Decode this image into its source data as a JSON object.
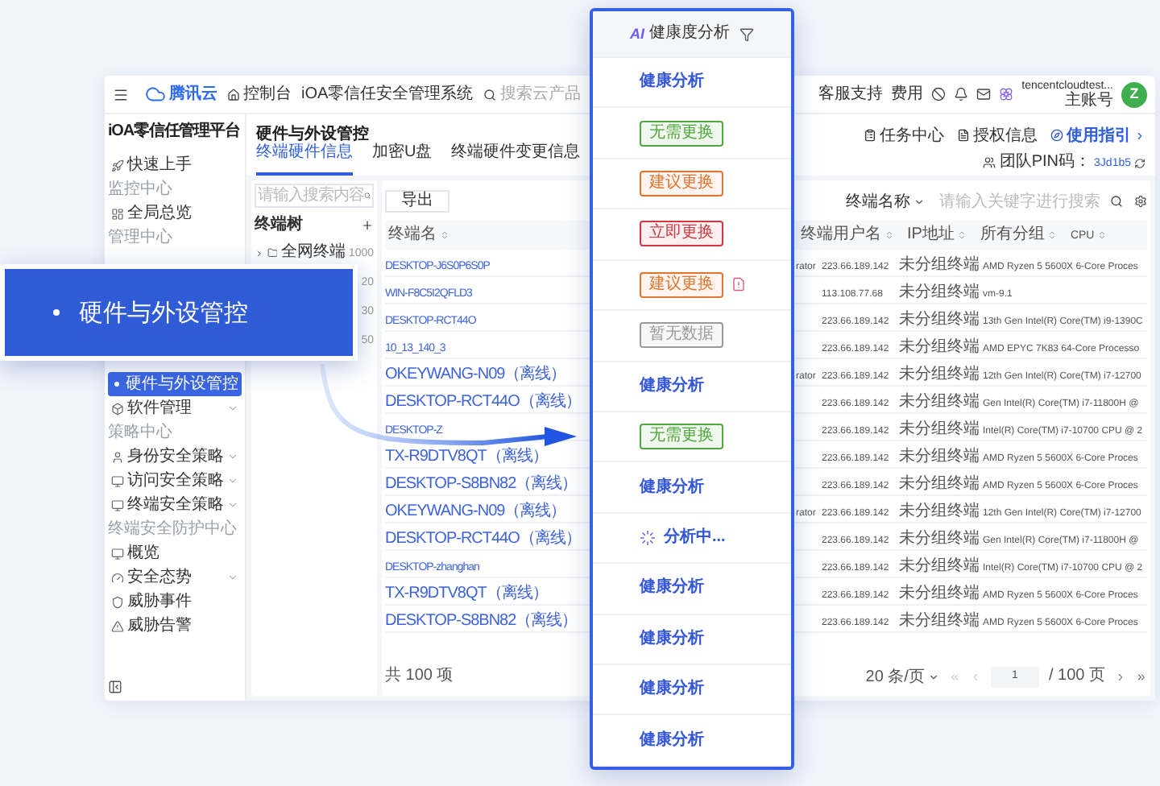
{
  "topbar": {
    "logo": "腾讯云",
    "console": "控制台",
    "product": "iOA零信任安全管理系统",
    "search": {
      "placeholder": "搜索云产品"
    },
    "links": [
      "客服支持",
      "费用"
    ],
    "account": {
      "name": "tencentcloudtest...",
      "role": "主账号",
      "avatar": "Z"
    }
  },
  "sidebar": {
    "title": "iOA零信任管理平台",
    "items": [
      {
        "kind": "item",
        "label": "快速上手",
        "selected": false,
        "expandable": false
      },
      {
        "kind": "heading",
        "label": "监控中心"
      },
      {
        "kind": "item",
        "label": "全局总览",
        "selected": false,
        "expandable": false
      },
      {
        "kind": "heading",
        "label": "管理中心"
      },
      {
        "kind": "item",
        "label": "硬件与外设管控",
        "selected": true,
        "expandable": false
      },
      {
        "kind": "item",
        "label": "软件管理",
        "selected": false,
        "expandable": true
      },
      {
        "kind": "heading",
        "label": "策略中心"
      },
      {
        "kind": "item",
        "label": "身份安全策略",
        "selected": false,
        "expandable": true
      },
      {
        "kind": "item",
        "label": "访问安全策略",
        "selected": false,
        "expandable": true
      },
      {
        "kind": "item",
        "label": "终端安全策略",
        "selected": false,
        "expandable": true
      },
      {
        "kind": "heading",
        "label": "终端安全防护中心"
      },
      {
        "kind": "item",
        "label": "概览",
        "selected": false,
        "expandable": false
      },
      {
        "kind": "item",
        "label": "安全态势",
        "selected": false,
        "expandable": true
      },
      {
        "kind": "item",
        "label": "威胁事件",
        "selected": false,
        "expandable": false
      },
      {
        "kind": "item",
        "label": "威胁告警",
        "selected": false,
        "expandable": false
      }
    ]
  },
  "page": {
    "title": "硬件与外设管控",
    "actions": [
      "任务中心",
      "授权信息",
      "使用指引"
    ],
    "pin": {
      "label": "团队PIN码：",
      "value": "3Jd1b5"
    },
    "tabs": [
      {
        "label": "终端硬件信息",
        "selected": true
      },
      {
        "label": "加密U盘",
        "selected": false
      },
      {
        "label": "终端硬件变更信息",
        "selected": false
      }
    ]
  },
  "tree": {
    "search": {
      "placeholder": "请输入搜索内容"
    },
    "title": "终端树",
    "root": {
      "label": "全网终端",
      "count": "1000",
      "children": [
        {
          "count": "20"
        },
        {
          "count": "30"
        },
        {
          "count": "50"
        }
      ]
    }
  },
  "table": {
    "export": "导出",
    "filter": {
      "field": "终端名称",
      "placeholder": "请输入关键字进行搜索"
    },
    "name_header": "终端名",
    "headers": [
      "终端用户名",
      "IP地址",
      "所有分组",
      "CPU"
    ],
    "rows": [
      {
        "name": "DESKTOP-J6S0P6S0P",
        "user": "rator",
        "ip": "223.66.189.142",
        "group": "未分组终端",
        "cpu": "AMD Ryzen 5 5600X 6-Core Proces"
      },
      {
        "name": "WIN-F8C5I2QFLD3",
        "ip": "113.108.77.68",
        "group": "未分组终端",
        "cpu": "vm-9.1"
      },
      {
        "name": "DESKTOP-RCT44O",
        "ip": "223.66.189.142",
        "group": "未分组终端",
        "cpu": "13th Gen Intel(R) Core(TM) i9-1390C"
      },
      {
        "name": "10_13_140_3",
        "ip": "223.66.189.142",
        "group": "未分组终端",
        "cpu": "AMD EPYC 7K83 64-Core Processo"
      },
      {
        "name": "OKEYWANG-N09（离线）",
        "user": "rator",
        "ip": "223.66.189.142",
        "group": "未分组终端",
        "cpu": "12th Gen Intel(R) Core(TM) i7-12700"
      },
      {
        "name": "DESKTOP-RCT44O（离线）",
        "ip": "223.66.189.142",
        "group": "未分组终端",
        "cpu": "Gen Intel(R) Core(TM) i7-11800H @"
      },
      {
        "name": "DESKTOP-Z",
        "ip": "223.66.189.142",
        "group": "未分组终端",
        "cpu": "Intel(R) Core(TM) i7-10700 CPU @ 2"
      },
      {
        "name": "TX-R9DTV8QT（离线）",
        "ip": "223.66.189.142",
        "group": "未分组终端",
        "cpu": "AMD Ryzen 5 5600X 6-Core Proces"
      },
      {
        "name": "DESKTOP-S8BN82（离线）",
        "ip": "223.66.189.142",
        "group": "未分组终端",
        "cpu": "AMD Ryzen 5 5600X 6-Core Proces"
      },
      {
        "name": "OKEYWANG-N09（离线）",
        "user": "rator",
        "ip": "223.66.189.142",
        "group": "未分组终端",
        "cpu": "12th Gen Intel(R) Core(TM) i7-12700"
      },
      {
        "name": "DESKTOP-RCT44O（离线）",
        "ip": "223.66.189.142",
        "group": "未分组终端",
        "cpu": "Gen Intel(R) Core(TM) i7-11800H @"
      },
      {
        "name": "DESKTOP-zhanghan",
        "ip": "223.66.189.142",
        "group": "未分组终端",
        "cpu": "Intel(R) Core(TM) i7-10700 CPU @ 2"
      },
      {
        "name": "TX-R9DTV8QT（离线）",
        "ip": "223.66.189.142",
        "group": "未分组终端",
        "cpu": "AMD Ryzen 5 5600X 6-Core Proces"
      },
      {
        "name": "DESKTOP-S8BN82（离线）",
        "ip": "223.66.189.142",
        "group": "未分组终端",
        "cpu": "AMD Ryzen 5 5600X 6-Core Proces"
      }
    ],
    "total": "共 100 项",
    "pagination": {
      "page_size": "20 条/页",
      "page": "1",
      "pages": "/ 100 页"
    }
  },
  "callout": {
    "label": "硬件与外设管控"
  },
  "health_panel": {
    "badge": "AI",
    "title": "健康度分析",
    "rows": [
      {
        "kind": "link",
        "label": "健康分析",
        "alert": false
      },
      {
        "kind": "tag",
        "label": "无需更换",
        "color": "#4ea83a",
        "alert": false
      },
      {
        "kind": "tag",
        "label": "建议更换",
        "color": "#e2742e",
        "alert": false
      },
      {
        "kind": "tag",
        "label": "立即更换",
        "color": "#d4383f",
        "alert": false
      },
      {
        "kind": "tag",
        "label": "建议更换",
        "color": "#e2742e",
        "alert": true
      },
      {
        "kind": "tag",
        "label": "暂无数据",
        "color": "#9a9a9a",
        "alert": false
      },
      {
        "kind": "link",
        "label": "健康分析",
        "alert": false
      },
      {
        "kind": "tag",
        "label": "无需更换",
        "color": "#4ea83a",
        "alert": false
      },
      {
        "kind": "link",
        "label": "健康分析",
        "alert": false
      },
      {
        "kind": "loading",
        "label": "分析中...",
        "alert": false
      },
      {
        "kind": "link",
        "label": "健康分析",
        "alert": false
      },
      {
        "kind": "link",
        "label": "健康分析",
        "alert": false
      },
      {
        "kind": "link",
        "label": "健康分析",
        "alert": false
      },
      {
        "kind": "link",
        "label": "健康分析",
        "alert": false
      }
    ]
  }
}
